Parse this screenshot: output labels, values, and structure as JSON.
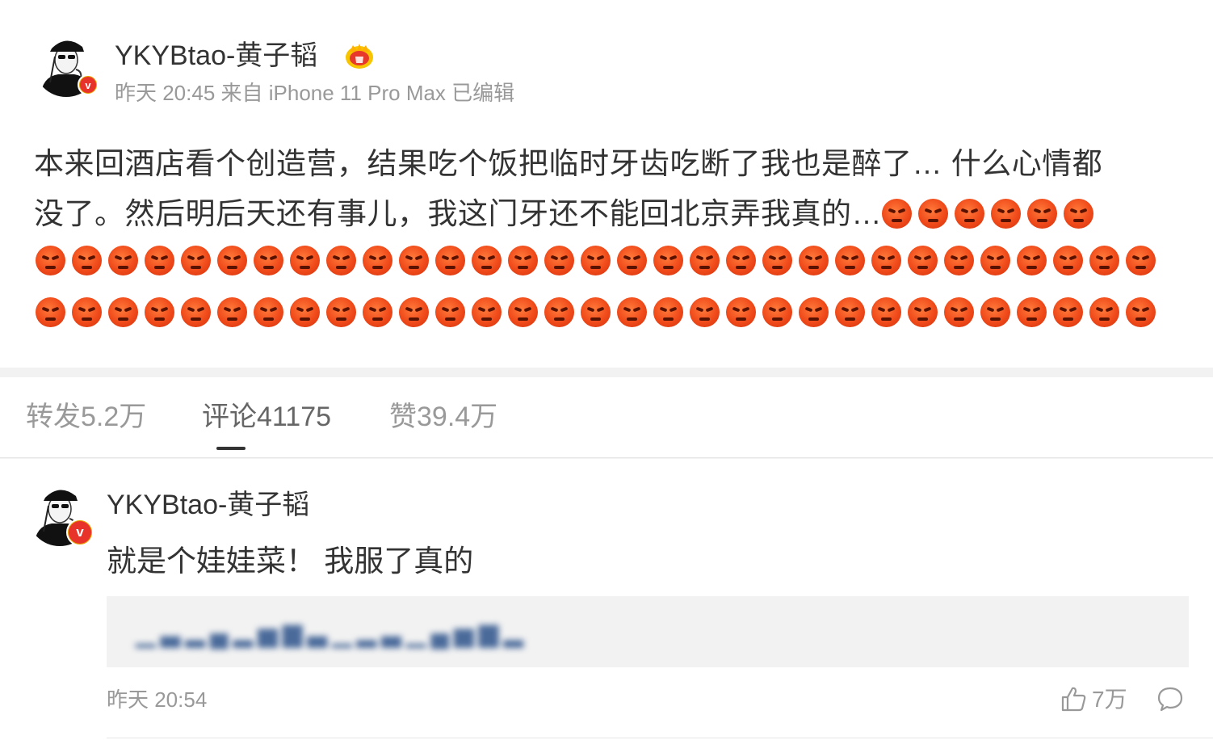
{
  "post": {
    "author": "YKYBtao-黄子韬",
    "meta": "昨天 20:45 来自 iPhone 11 Pro Max 已编辑",
    "text_line1": "本来回酒店看个创造营，结果吃个饭把临时牙齿吃断了我也是醉了… 什么心情都",
    "text_line2": "没了。然后明后天还有事儿，我这门牙还不能回北京弄我真的…",
    "inline_angry_emoji_count": 6,
    "angry_emoji_row_counts": [
      31,
      31
    ],
    "badge_letter": "v"
  },
  "tabs": [
    {
      "label": "转发5.2万"
    },
    {
      "label": "评论41175"
    },
    {
      "label": "赞39.4万"
    }
  ],
  "active_tab": "评论41175",
  "comment": {
    "author": "YKYBtao-黄子韬",
    "text": "就是个娃娃菜！ 我服了真的",
    "time": "昨天 20:54",
    "likes": "7万",
    "badge_letter": "v",
    "quoted_blurred": true
  },
  "icons": [
    "crown-icon",
    "angry-face-emoji",
    "thumbs-up-icon",
    "comment-bubble-icon"
  ],
  "colors": {
    "badge_red": "#e8332b",
    "badge_ring": "#e8a200",
    "emoji_red": "#f04a1a",
    "meta_gray": "#999999"
  }
}
